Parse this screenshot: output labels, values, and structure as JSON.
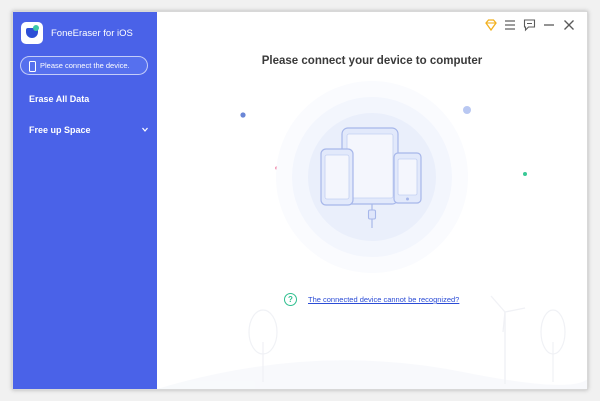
{
  "app": {
    "title": "FoneEraser for iOS"
  },
  "sidebar": {
    "device_status": "Please connect the device.",
    "items": [
      {
        "label": "Erase All Data"
      },
      {
        "label": "Free up Space"
      }
    ]
  },
  "main": {
    "title": "Please connect your device to computer",
    "help_link": "The connected device cannot be recognized?",
    "help_icon_glyph": "?"
  },
  "icons": {
    "premium": "diamond-icon",
    "menu": "menu-icon",
    "feedback": "feedback-icon",
    "minimize": "minimize-icon",
    "close": "close-icon"
  },
  "colors": {
    "sidebar": "#4a62e8",
    "accent": "#2b4cd6",
    "help": "#2fbf8f",
    "premium": "#f2b01e"
  }
}
